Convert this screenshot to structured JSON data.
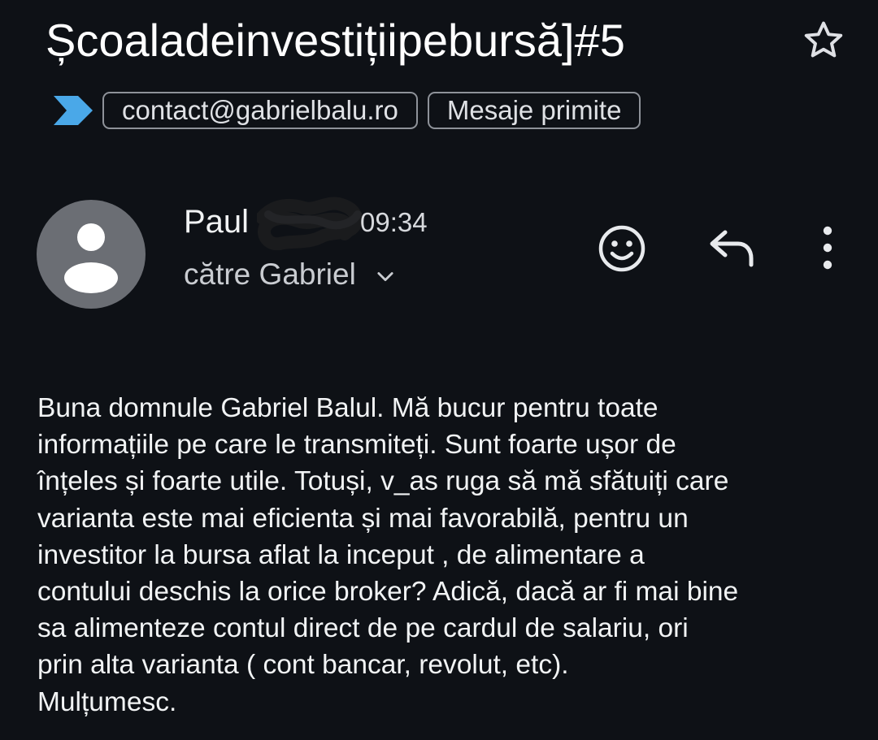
{
  "email": {
    "subject": "Școaladeinvestițiipebursă]#5",
    "starred": false,
    "labels": [
      {
        "label": "contact@gabrielbalu.ro"
      },
      {
        "label": "Mesaje primite"
      }
    ],
    "importance_color": "#4aa8e8",
    "sender_name": "Paul",
    "time": "09:34",
    "recipient": "către Gabriel",
    "body_lines": [
      "Buna domnule Gabriel Balul. Mă bucur pentru toate",
      "informațiile pe care le transmiteți. Sunt foarte ușor de",
      "înțeles și foarte utile. Totuși, v_as ruga să mă sfătuiți care",
      "varianta este mai eficienta și mai favorabilă, pentru un",
      "investitor la bursa aflat la inceput , de alimentare a",
      "contului deschis la orice broker? Adică, dacă ar fi mai bine",
      "sa alimenteze contul direct de pe cardul de salariu, ori",
      "prin alta varianta ( cont bancar, revolut, etc).",
      "Mulțumesc."
    ]
  },
  "actions": {
    "star_icon": "star-outline",
    "react_icon": "smiley-face",
    "reply_icon": "reply-arrow",
    "more_icon": "vertical-ellipsis"
  },
  "colors": {
    "background": "#0e1116",
    "avatar": "#6b6e74",
    "chip_border": "#8e9299"
  }
}
